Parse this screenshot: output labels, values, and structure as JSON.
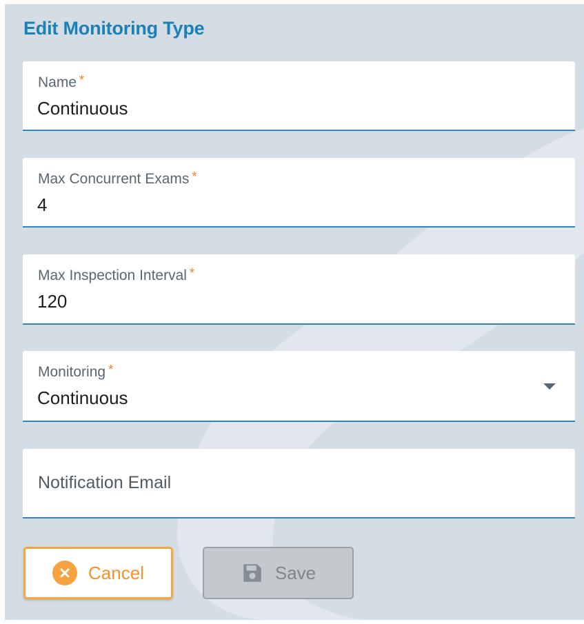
{
  "form": {
    "title": "Edit Monitoring Type",
    "required_mark": "*",
    "fields": {
      "name": {
        "label": "Name",
        "value": "Continuous"
      },
      "max_concurrent_exams": {
        "label": "Max Concurrent Exams",
        "value": "4"
      },
      "max_inspection_interval": {
        "label": "Max Inspection Interval",
        "value": "120"
      },
      "monitoring": {
        "label": "Monitoring",
        "value": "Continuous"
      },
      "notification_email": {
        "label": "Notification Email",
        "value": ""
      }
    },
    "buttons": {
      "cancel": {
        "label": "Cancel",
        "icon": "close-circle-icon"
      },
      "save": {
        "label": "Save",
        "icon": "floppy-disk-icon",
        "disabled": true
      }
    }
  },
  "colors": {
    "accent": "#1b80b5",
    "field_underline": "#2b87b9",
    "required": "#f07e1c",
    "cancel": "#f5922a",
    "panel_bg": "#d3dde3"
  }
}
